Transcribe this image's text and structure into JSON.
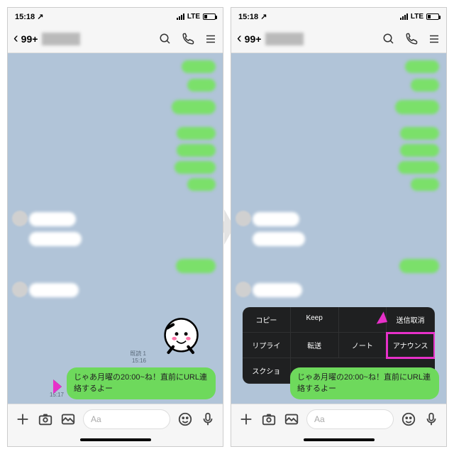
{
  "statusbar": {
    "time": "15:18",
    "net": "LTE"
  },
  "header": {
    "back_badge": "99+"
  },
  "message": {
    "text": "じゃあ月曜の20:00~ね！直前にURL連絡するよー",
    "time": "15:17",
    "sticker_read1": "既読 1",
    "sticker_time": "15:16"
  },
  "input": {
    "placeholder": "Aa"
  },
  "ctx": {
    "copy": "コピー",
    "keep": "Keep",
    "dummy": "",
    "unsend": "送信取消",
    "reply": "リプライ",
    "forward": "転送",
    "note": "ノート",
    "announce": "アナウンス",
    "screenshot": "スクショ"
  }
}
